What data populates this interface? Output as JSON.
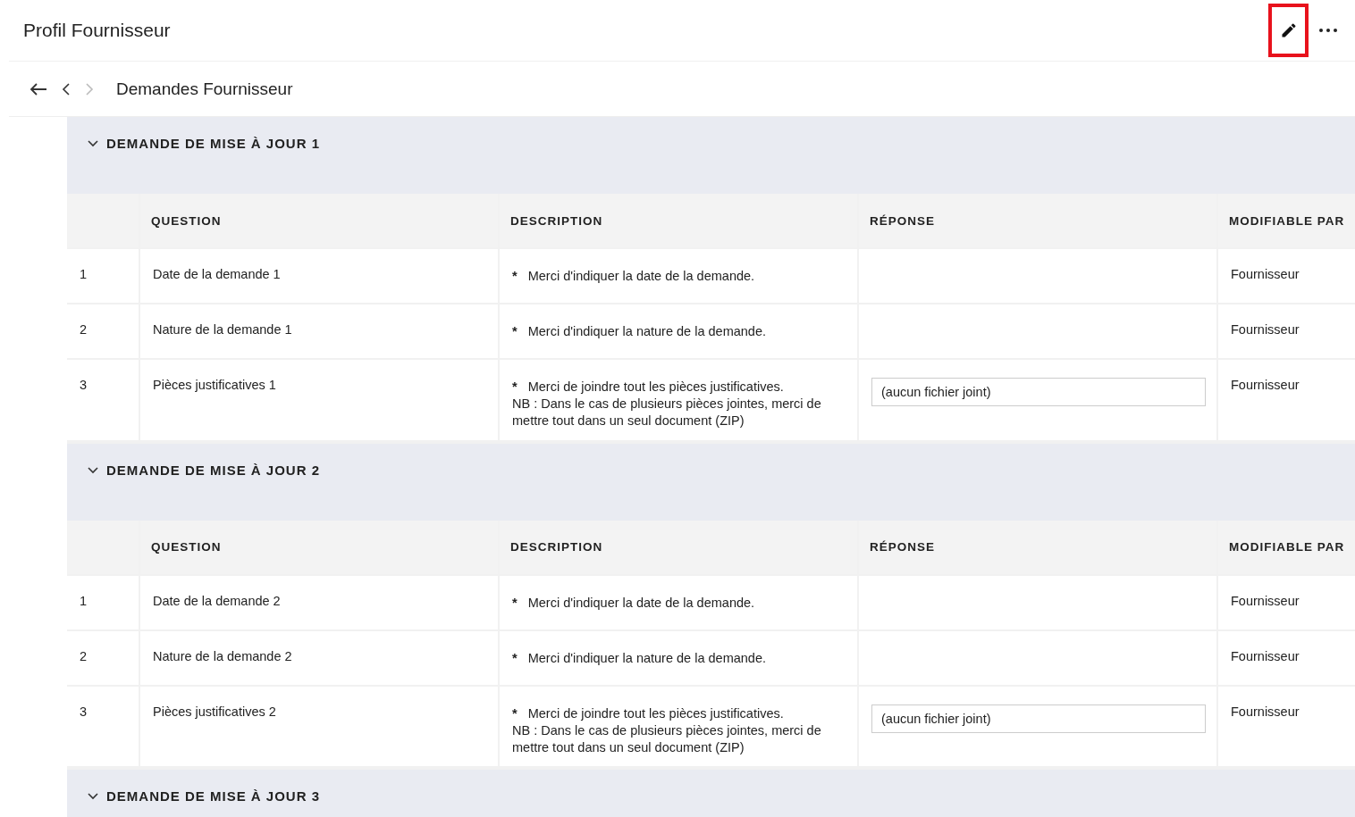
{
  "header": {
    "title": "Profil Fournisseur",
    "edit_highlighted": true
  },
  "breadcrumb": {
    "title": "Demandes Fournisseur"
  },
  "sections": [
    {
      "title": "DEMANDE DE MISE À JOUR 1",
      "expanded": true,
      "columns": [
        "QUESTION",
        "DESCRIPTION",
        "RÉPONSE",
        "MODIFIABLE PAR"
      ],
      "rows": [
        {
          "number": "1",
          "question": "Date de la demande 1",
          "marker": "*",
          "description": "Merci d'indiquer la date de la demande.",
          "editor": "Fournisseur"
        },
        {
          "number": "2",
          "question": "Nature de la demande 1",
          "marker": "*",
          "description": "Merci d'indiquer la nature de la demande.",
          "editor": "Fournisseur"
        },
        {
          "number": "3",
          "question": "Pièces justificatives 1",
          "marker": "*",
          "description": "Merci de joindre tout les pièces justificatives.",
          "note": "NB : Dans le cas de plusieurs pièces jointes, merci de mettre tout dans un seul document (ZIP)",
          "response": "(aucun fichier joint)",
          "editor": "Fournisseur"
        }
      ]
    },
    {
      "title": "DEMANDE DE MISE À JOUR 2",
      "expanded": true,
      "columns": [
        "QUESTION",
        "DESCRIPTION",
        "RÉPONSE",
        "MODIFIABLE PAR"
      ],
      "rows": [
        {
          "number": "1",
          "question": "Date de la demande 2",
          "marker": "*",
          "description": "Merci d'indiquer la date de la demande.",
          "editor": "Fournisseur"
        },
        {
          "number": "2",
          "question": "Nature de la demande 2",
          "marker": "*",
          "description": "Merci d'indiquer la nature de la demande.",
          "editor": "Fournisseur"
        },
        {
          "number": "3",
          "question": "Pièces justificatives 2",
          "marker": "*",
          "description": "Merci de joindre tout les pièces justificatives.",
          "note": "NB : Dans le cas de plusieurs pièces jointes, merci de mettre tout dans un seul document (ZIP)",
          "response": "(aucun fichier joint)",
          "editor": "Fournisseur"
        }
      ]
    },
    {
      "title": "DEMANDE DE MISE À JOUR 3",
      "expanded": true
    }
  ]
}
